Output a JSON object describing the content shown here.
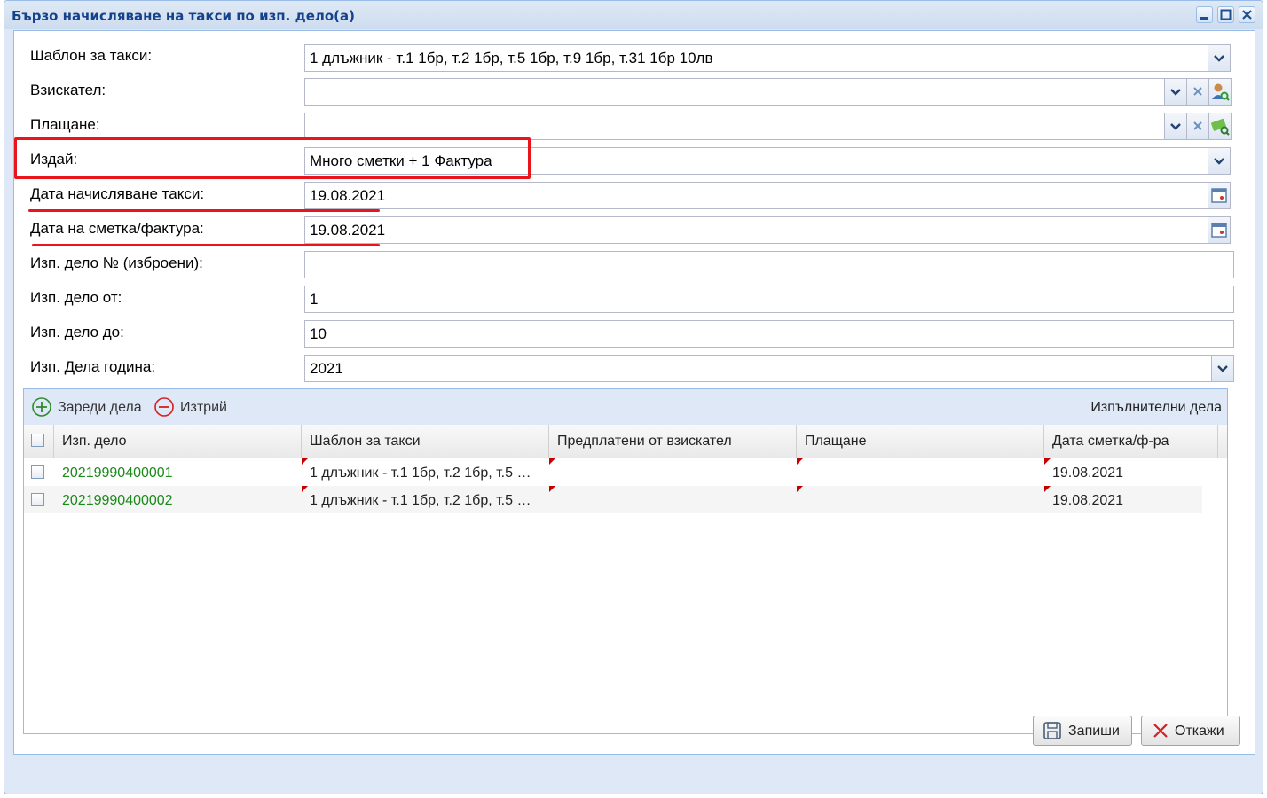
{
  "window": {
    "title": "Бързо начисляване на такси по изп. дело(а)"
  },
  "form": {
    "template": {
      "label": "Шаблон за такси:",
      "value": "1 длъжник - т.1 1бр, т.2 1бр, т.5 1бр, т.9 1бр, т.31 1бр 10лв"
    },
    "claimant": {
      "label": "Взискател:",
      "value": ""
    },
    "payment": {
      "label": "Плащане:",
      "value": ""
    },
    "issue": {
      "label": "Издай:",
      "value": "Много сметки + 1 Фактура"
    },
    "fee_date": {
      "label": "Дата начисляване такси:",
      "value": "19.08.2021"
    },
    "invoice_date": {
      "label": "Дата на сметка/фактура:",
      "value": "19.08.2021"
    },
    "case_list": {
      "label": "Изп. дело № (изброени):",
      "value": ""
    },
    "case_from": {
      "label": "Изп. дело от:",
      "value": "1"
    },
    "case_to": {
      "label": "Изп. дело до:",
      "value": "10"
    },
    "case_year": {
      "label": "Изп. Дела година:",
      "value": "2021"
    }
  },
  "grid": {
    "load_label": "Зареди дела",
    "delete_label": "Изтрий",
    "title": "Изпълнителни дела",
    "columns": [
      "Изп. дело",
      "Шаблон за такси",
      "Предплатени от взискател",
      "Плащане",
      "Дата сметка/ф-ра"
    ],
    "rows": [
      {
        "case": "20219990400001",
        "template": "1 длъжник - т.1 1бр, т.2 1бр, т.5 …",
        "prepaid": "",
        "payment": "",
        "date": "19.08.2021"
      },
      {
        "case": "20219990400002",
        "template": "1 длъжник - т.1 1бр, т.2 1бр, т.5 …",
        "prepaid": "",
        "payment": "",
        "date": "19.08.2021"
      }
    ]
  },
  "buttons": {
    "save": "Запиши",
    "cancel": "Откажи"
  },
  "colors": {
    "highlight": "#e8161c",
    "case_link": "#1a8a1a",
    "title": "#15428b"
  }
}
